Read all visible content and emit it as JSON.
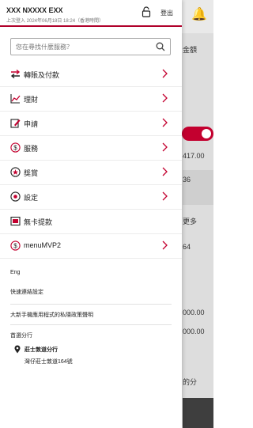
{
  "header": {
    "name": "XXX NXXXX EXX",
    "last_login": "上次登入 2024年06月18日 18:24（香港時間）",
    "logout_label": "登出"
  },
  "search": {
    "placeholder": "您在尋找什麼服務？"
  },
  "menu": {
    "items": [
      {
        "label": "轉賬及付款",
        "icon": "transfer-icon"
      },
      {
        "label": "理財",
        "icon": "chart-icon"
      },
      {
        "label": "申請",
        "icon": "form-icon"
      },
      {
        "label": "服務",
        "icon": "dollar-icon"
      },
      {
        "label": "獎賞",
        "icon": "star-icon"
      },
      {
        "label": "設定",
        "icon": "gear-icon"
      },
      {
        "label": "無卡提款",
        "icon": "cardless-icon"
      },
      {
        "label": "menuMVP2",
        "icon": "dollar-icon"
      }
    ]
  },
  "links": {
    "language": "Eng",
    "quick_settings": "快速連結設定",
    "privacy": "大新手機應用程式的私隱政策聲明"
  },
  "branch": {
    "title": "首選分行",
    "name": "莊士敦道分行",
    "address": "灣仔莊士敦道164號"
  },
  "background": {
    "fragments": [
      "金額",
      "417.00",
      "36",
      "更多",
      "64",
      "000.00",
      "000.00",
      "的分"
    ]
  },
  "colors": {
    "accent": "#b0002a"
  }
}
